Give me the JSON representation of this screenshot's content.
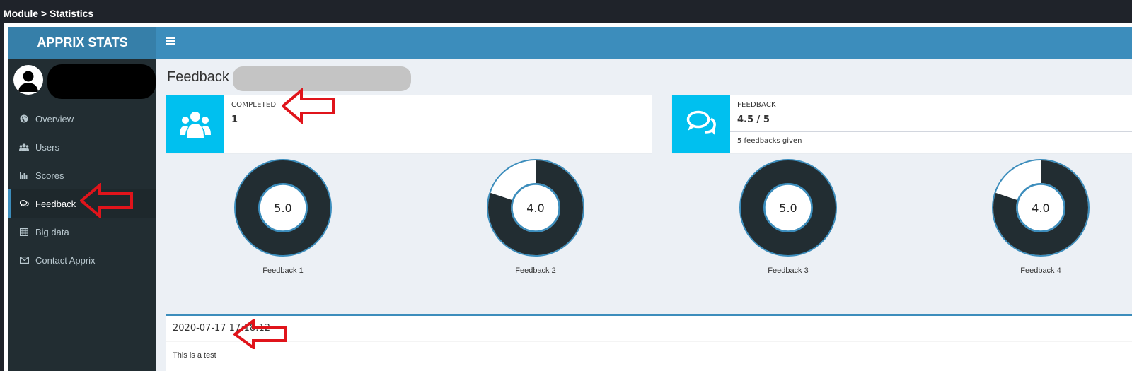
{
  "breadcrumb": "Module > Statistics",
  "brand": "APPRIX STATS",
  "sidebar": {
    "items": [
      {
        "label": "Overview",
        "icon": "globe-icon"
      },
      {
        "label": "Users",
        "icon": "users-icon"
      },
      {
        "label": "Scores",
        "icon": "bar-chart-icon"
      },
      {
        "label": "Feedback",
        "icon": "comments-icon",
        "active": true
      },
      {
        "label": "Big data",
        "icon": "table-icon"
      },
      {
        "label": "Contact Apprix",
        "icon": "envelope-icon"
      }
    ]
  },
  "page": {
    "title": "Feedback"
  },
  "info_completed": {
    "label": "COMPLETED",
    "value": "1"
  },
  "info_feedback": {
    "label": "FEEDBACK",
    "value": "4.5 / 5",
    "description": "5 feedbacks given"
  },
  "donuts": [
    {
      "label": "Feedback 1",
      "value": "5.0",
      "fraction": 1.0
    },
    {
      "label": "Feedback 2",
      "value": "4.0",
      "fraction": 0.8
    },
    {
      "label": "Feedback 3",
      "value": "5.0",
      "fraction": 1.0
    },
    {
      "label": "Feedback 4",
      "value": "4.0",
      "fraction": 0.8
    }
  ],
  "feedback_entry": {
    "date": "2020-07-17 17:18:12",
    "text": "This is a test"
  },
  "colors": {
    "accent": "#3c8dbc",
    "info": "#00c0ef",
    "sidebar": "#222d32",
    "donut_fill": "#222d32",
    "annotation": "#e0141b"
  }
}
